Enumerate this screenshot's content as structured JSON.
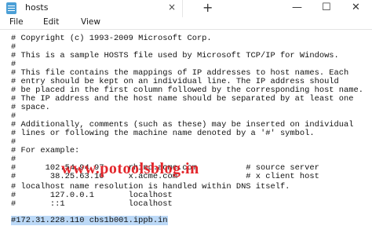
{
  "window": {
    "tab_title": "hosts",
    "tab_close": "×",
    "new_tab": "+",
    "minimize": "—",
    "maximize": "☐",
    "close": "✕"
  },
  "menu": {
    "file": "File",
    "edit": "Edit",
    "view": "View"
  },
  "watermark": "www.potoolsblog.in",
  "editor": {
    "lines": [
      "# Copyright (c) 1993-2009 Microsoft Corp.",
      "#",
      "# This is a sample HOSTS file used by Microsoft TCP/IP for Windows.",
      "#",
      "# This file contains the mappings of IP addresses to host names. Each",
      "# entry should be kept on an individual line. The IP address should",
      "# be placed in the first column followed by the corresponding host name.",
      "# The IP address and the host name should be separated by at least one",
      "# space.",
      "#",
      "# Additionally, comments (such as these) may be inserted on individual",
      "# lines or following the machine name denoted by a '#' symbol.",
      "#",
      "# For example:",
      "#",
      "#      102.54.94.97     rhino.acme.com          # source server",
      "#       38.25.63.10     x.acme.com              # x client host",
      "",
      "# localhost name resolution is handled within DNS itself.",
      "#       127.0.0.1       localhost",
      "#       ::1             localhost",
      "",
      "#172.31.228.110 cbs1b001.ippb.in"
    ]
  }
}
